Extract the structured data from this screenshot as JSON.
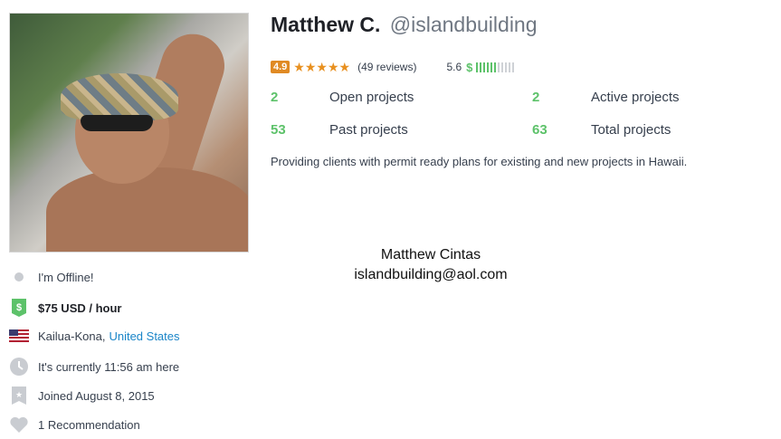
{
  "profile": {
    "name": "Matthew C.",
    "handle": "@islandbuilding",
    "rating": "4.9",
    "reviews": "(49 reviews)",
    "earnings_score": "5.6",
    "earnings_symbol": "$",
    "earnings_bars_filled": 6,
    "earnings_bars_total": 11,
    "description": "Providing clients with permit ready plans for existing and new projects in Hawaii."
  },
  "stats": [
    {
      "value": "2",
      "label": "Open projects"
    },
    {
      "value": "2",
      "label": "Active projects"
    },
    {
      "value": "53",
      "label": "Past projects"
    },
    {
      "value": "63",
      "label": "Total projects"
    }
  ],
  "overlay": {
    "line1": "Matthew Cintas",
    "line2": "islandbuilding@aol.com"
  },
  "sidebar": {
    "status": "I'm Offline!",
    "rate": "$75 USD / hour",
    "city": "Kailua-Kona,",
    "country": "United States",
    "local_time": "It's currently 11:56 am here",
    "joined": "Joined August 8, 2015",
    "recommendations": "1 Recommendation"
  },
  "colors": {
    "accent_green": "#5dc26a",
    "rating_orange": "#e08a24",
    "link_blue": "#1a85c8"
  },
  "icons": [
    "offline-dot-icon",
    "dollar-tag-icon",
    "us-flag-icon",
    "clock-icon",
    "joined-badge-icon",
    "heart-icon",
    "star-icon"
  ]
}
